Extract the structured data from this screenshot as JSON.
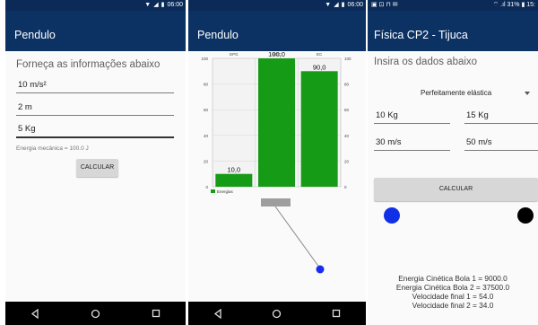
{
  "phone1": {
    "status_time": "06:00",
    "app_title": "Pendulo",
    "heading": "Forneça as informações abaixo",
    "fields": [
      {
        "value": "10 m/s²"
      },
      {
        "value": "2 m"
      },
      {
        "value": "5 Kg"
      }
    ],
    "energy_text": "Energia mecânica = 100.0 J",
    "calc_label": "CALCULAR"
  },
  "phone2": {
    "status_time": "06:00",
    "app_title": "Pendulo",
    "chart_data": {
      "type": "bar",
      "categories": [
        "EPG",
        "MEC",
        "EC"
      ],
      "values": [
        10.0,
        100.0,
        90.0
      ],
      "value_labels": [
        "10,0",
        "100,0",
        "90,0"
      ],
      "series": [
        {
          "name": "Energias",
          "values": [
            10.0,
            100.0,
            90.0
          ]
        }
      ],
      "ylim": [
        0,
        100
      ],
      "y_ticks": [
        "0",
        "20",
        "40",
        "60",
        "80",
        "100"
      ],
      "legend_position": "bottom-left",
      "bar_color": "#169b16",
      "grid": true
    }
  },
  "phone3": {
    "status_left": "▣ ⊡ ⊓ ✉",
    "status_right": "⌔ .ıl 31% ▮ 15:",
    "app_title": "Física CP2 - Tijuca",
    "heading": "Insira os dados abaixo",
    "dropdown_value": "Perfeitamente elástica",
    "fields": [
      {
        "value": "10 Kg"
      },
      {
        "value": "15 Kg"
      },
      {
        "value": "30 m/s"
      },
      {
        "value": "50 m/s"
      }
    ],
    "calc_label": "CALCULAR",
    "results": [
      "Energia Cinética Bola 1  = 9000.0",
      "Energia Cinética Bola 2 = 37500.0",
      "Velocidade final 1 = 54.0",
      "Velocidade final 2 = 34.0"
    ],
    "ball1_color": "#1030e6",
    "ball2_color": "#000000"
  }
}
